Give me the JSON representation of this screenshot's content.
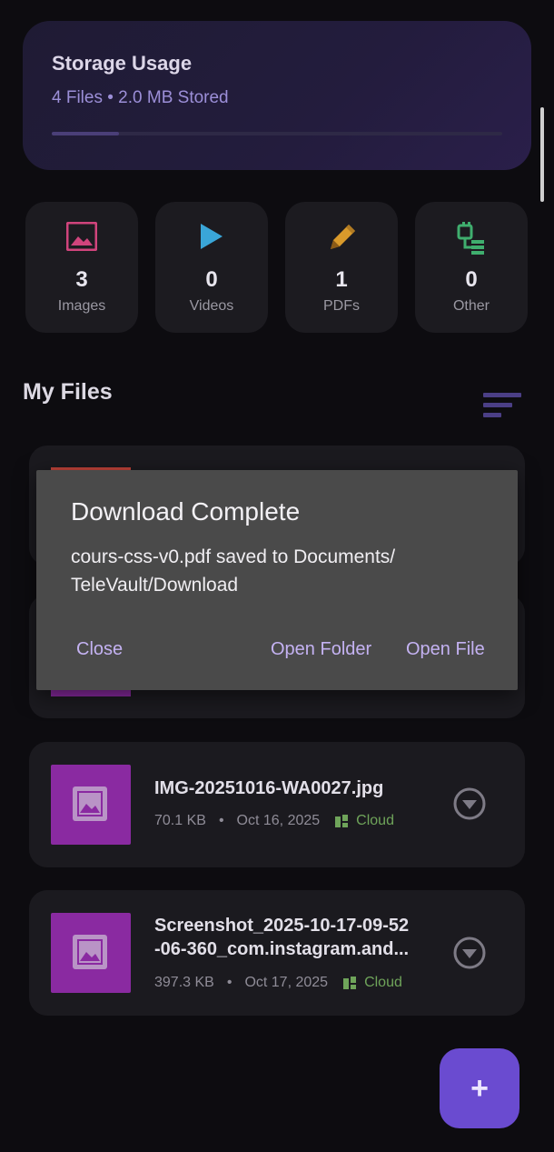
{
  "storage": {
    "title": "Storage Usage",
    "subtitle": "4 Files • 2.0 MB Stored",
    "usage_fraction": 0.15
  },
  "stats": [
    {
      "count": "3",
      "label": "Images",
      "icon": "image-icon",
      "color": "#d0447c"
    },
    {
      "count": "0",
      "label": "Videos",
      "icon": "play-icon",
      "color": "#3aa6d8"
    },
    {
      "count": "1",
      "label": "PDFs",
      "icon": "pencil-icon",
      "color": "#d99a2b"
    },
    {
      "count": "0",
      "label": "Other",
      "icon": "files-icon",
      "color": "#3fae6e"
    }
  ],
  "section_title": "My Files",
  "files": [
    {
      "name": "IMG-20251016-WA0027.jpg",
      "size": "70.1 KB",
      "date": "Oct 16, 2025",
      "location": "Cloud"
    },
    {
      "name": "Screenshot_2025-10-17-09-52-06-360_com.instagram.and...",
      "name_line1": "Screenshot_2025-10-17-09-52",
      "name_line2": "-06-360_com.instagram.and...",
      "size": "397.3 KB",
      "date": "Oct 17, 2025",
      "location": "Cloud"
    }
  ],
  "dialog": {
    "title": "Download Complete",
    "message": "cours-css-v0.pdf saved to Documents/ TeleVault/Download",
    "close_label": "Close",
    "open_folder_label": "Open Folder",
    "open_file_label": "Open File"
  },
  "fab_label": "+",
  "colors": {
    "accent": "#6a4bd0",
    "thumb": "#8a2aa1",
    "cloud": "#6fa45a"
  }
}
